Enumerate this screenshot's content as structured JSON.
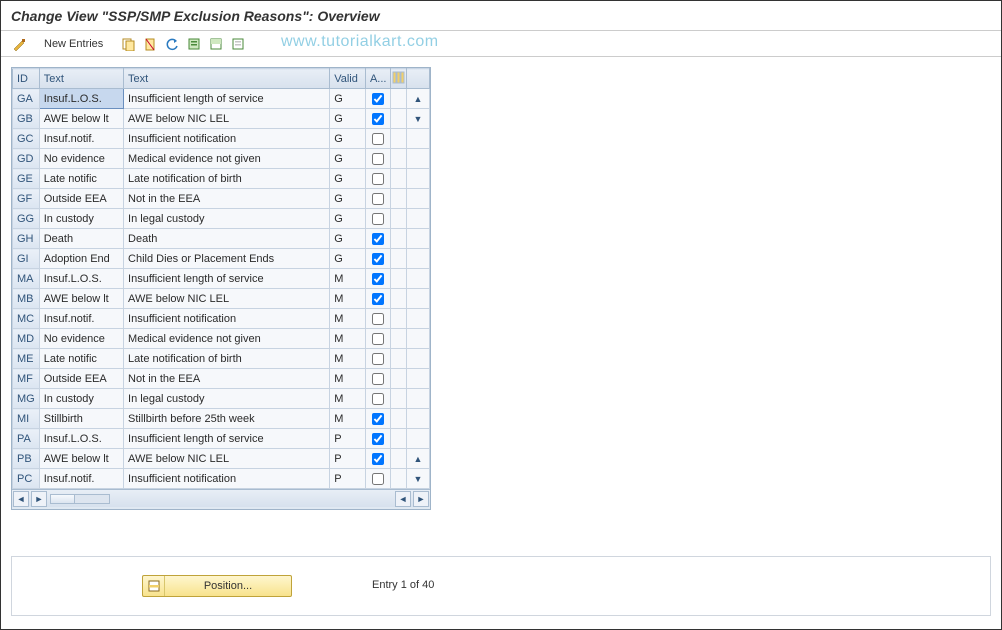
{
  "title": "Change View \"SSP/SMP Exclusion Reasons\": Overview",
  "toolbar": {
    "new_entries": "New Entries"
  },
  "watermark": "www.tutorialkart.com",
  "columns": {
    "id": "ID",
    "text1": "Text",
    "text2": "Text",
    "valid": "Valid",
    "a": "A..."
  },
  "rows": [
    {
      "id": "GA",
      "t1": "Insuf.L.O.S.",
      "t2": "Insufficient length of service",
      "valid": "G",
      "a": true,
      "sel": true
    },
    {
      "id": "GB",
      "t1": "AWE below lt",
      "t2": "AWE below NIC LEL",
      "valid": "G",
      "a": true
    },
    {
      "id": "GC",
      "t1": "Insuf.notif.",
      "t2": "Insufficient notification",
      "valid": "G",
      "a": false
    },
    {
      "id": "GD",
      "t1": "No evidence",
      "t2": "Medical evidence not given",
      "valid": "G",
      "a": false
    },
    {
      "id": "GE",
      "t1": "Late notific",
      "t2": "Late notification of birth",
      "valid": "G",
      "a": false
    },
    {
      "id": "GF",
      "t1": "Outside EEA",
      "t2": "Not in the EEA",
      "valid": "G",
      "a": false
    },
    {
      "id": "GG",
      "t1": "In custody",
      "t2": "In legal custody",
      "valid": "G",
      "a": false
    },
    {
      "id": "GH",
      "t1": "Death",
      "t2": "Death",
      "valid": "G",
      "a": true
    },
    {
      "id": "GI",
      "t1": "Adoption End",
      "t2": "Child Dies or Placement Ends",
      "valid": "G",
      "a": true
    },
    {
      "id": "MA",
      "t1": "Insuf.L.O.S.",
      "t2": "Insufficient length of service",
      "valid": "M",
      "a": true
    },
    {
      "id": "MB",
      "t1": "AWE below lt",
      "t2": "AWE below NIC LEL",
      "valid": "M",
      "a": true
    },
    {
      "id": "MC",
      "t1": "Insuf.notif.",
      "t2": "Insufficient notification",
      "valid": "M",
      "a": false
    },
    {
      "id": "MD",
      "t1": "No evidence",
      "t2": "Medical evidence not given",
      "valid": "M",
      "a": false
    },
    {
      "id": "ME",
      "t1": "Late notific",
      "t2": "Late notification of birth",
      "valid": "M",
      "a": false
    },
    {
      "id": "MF",
      "t1": "Outside EEA",
      "t2": "Not in the EEA",
      "valid": "M",
      "a": false
    },
    {
      "id": "MG",
      "t1": "In custody",
      "t2": "In legal custody",
      "valid": "M",
      "a": false
    },
    {
      "id": "MI",
      "t1": "Stillbirth",
      "t2": "Stillbirth before 25th week",
      "valid": "M",
      "a": true
    },
    {
      "id": "PA",
      "t1": "Insuf.L.O.S.",
      "t2": "Insufficient length of service",
      "valid": "P",
      "a": true
    },
    {
      "id": "PB",
      "t1": "AWE below lt",
      "t2": "AWE below NIC LEL",
      "valid": "P",
      "a": true
    },
    {
      "id": "PC",
      "t1": "Insuf.notif.",
      "t2": "Insufficient notification",
      "valid": "P",
      "a": false
    }
  ],
  "position_button": "Position...",
  "entry_status": "Entry 1 of 40"
}
